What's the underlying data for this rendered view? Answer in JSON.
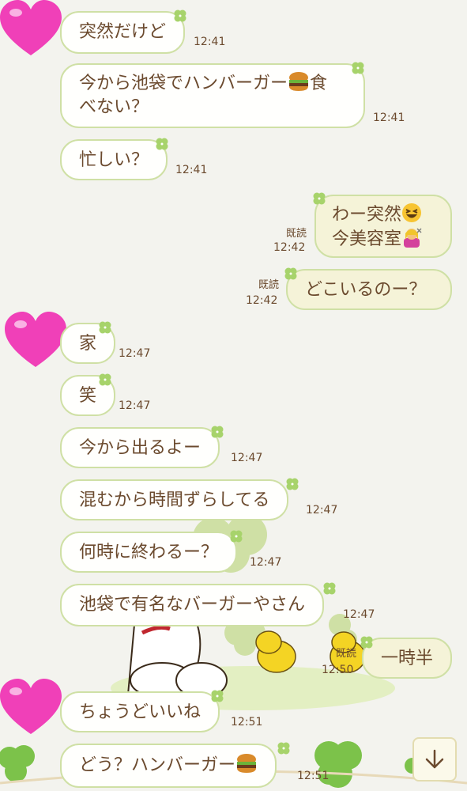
{
  "messages": [
    {
      "id": "m1",
      "text": "突然だけど",
      "time": "12:41"
    },
    {
      "id": "m2",
      "line1": "今から池袋でハンバーガー",
      "emoji1": "hamburger-emoji",
      "line1b": "食",
      "line2": "べない？",
      "time": "12:41"
    },
    {
      "id": "m3",
      "text": "忙しい？",
      "time": "12:41"
    },
    {
      "id": "m4",
      "line1": "わー突然",
      "line2": "今美容室",
      "read": "既読",
      "time": "12:42"
    },
    {
      "id": "m5",
      "text": "どこいるのー？",
      "read": "既読",
      "time": "12:42"
    },
    {
      "id": "m6",
      "text": "家",
      "time": "12:47"
    },
    {
      "id": "m7",
      "text": "笑",
      "time": "12:47"
    },
    {
      "id": "m8",
      "text": "今から出るよー",
      "time": "12:47"
    },
    {
      "id": "m9",
      "text": "混むから時間ずらしてる",
      "time": "12:47"
    },
    {
      "id": "m10",
      "text": "何時に終わるー？",
      "time": "12:47"
    },
    {
      "id": "m11",
      "text": "池袋で有名なバーガーやさん",
      "time": "12:47"
    },
    {
      "id": "m12",
      "text": "一時半",
      "read": "既読",
      "time": "12:50"
    },
    {
      "id": "m13",
      "text": "ちょうどいいね",
      "time": "12:51"
    },
    {
      "id": "m14",
      "text": "どう？ハンバーガー",
      "time": "12:51"
    }
  ],
  "colors": {
    "bubble_border": "#cfe0a5",
    "text": "#6b4a2e",
    "avatar_heart": "#f040b8",
    "background": "#f3f3ee"
  },
  "icons": {
    "avatar": "pink-heart-icon",
    "clover": "four-leaf-clover-icon",
    "scroll": "arrow-down-icon"
  }
}
